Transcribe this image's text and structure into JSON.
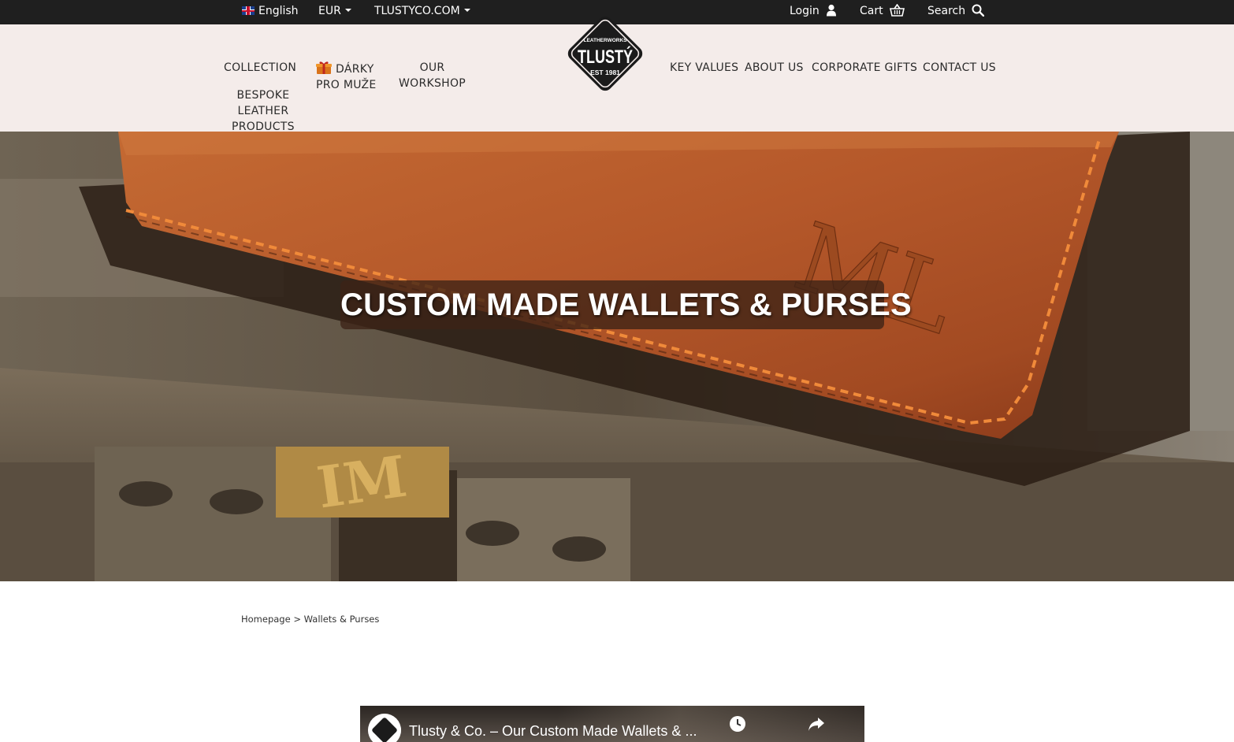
{
  "topbar": {
    "language": "English",
    "currency": "EUR",
    "site": "TLUSTYCO.COM",
    "login": "Login",
    "cart": "Cart",
    "search": "Search"
  },
  "nav": {
    "collection": "COLLECTION",
    "gifts_line1": "DÁRKY",
    "gifts_line2": "PRO MUŽE",
    "workshop_line1": "OUR",
    "workshop_line2": "WORKSHOP",
    "bespoke_line1": "BESPOKE",
    "bespoke_line2": "LEATHER",
    "bespoke_line3": "PRODUCTS",
    "key_values": "KEY VALUES",
    "about_us": "ABOUT US",
    "corporate_gifts": "CORPORATE GIFTS",
    "contact_us": "CONTACT US"
  },
  "logo": {
    "top_text": "LEATHERWORKS",
    "brand": "TLUSTÝ",
    "est": "EST 1981"
  },
  "hero": {
    "title": "CUSTOM MADE WALLETS & PURSES",
    "wallet_monogram": "ML",
    "type_letters": "IM"
  },
  "breadcrumb": {
    "home": "Homepage",
    "separator": ">",
    "current": "Wallets & Purses"
  },
  "video": {
    "title": "Tlusty & Co. – Our Custom Made Wallets & ..."
  },
  "colors": {
    "topbar_bg": "#1f1f1f",
    "header_bg": "#f4ecea",
    "leather": "#b4592a",
    "stitch": "#f08a3a"
  }
}
